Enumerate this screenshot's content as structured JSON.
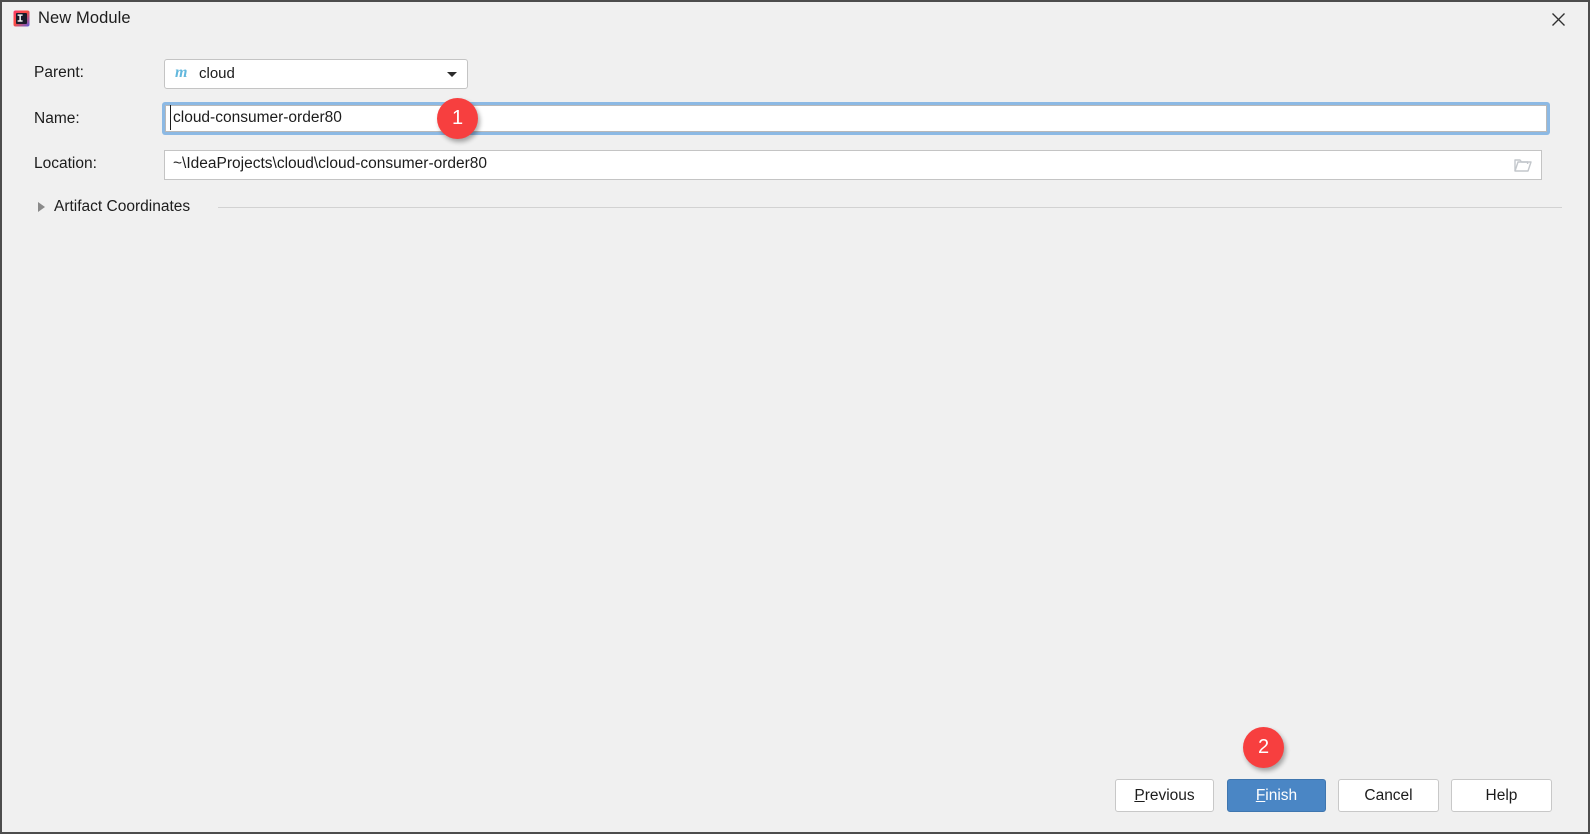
{
  "window": {
    "title": "New Module",
    "app_icon": "intellij-idea-icon",
    "close_icon": "close-icon"
  },
  "form": {
    "parent": {
      "label": "Parent:",
      "value": "cloud",
      "icon": "maven-module-icon",
      "icon_glyph": "m",
      "dropdown_icon": "chevron-down-icon"
    },
    "name": {
      "label": "Name:",
      "value": "cloud-consumer-order80",
      "placeholder": ""
    },
    "location": {
      "label": "Location:",
      "value": "~\\IdeaProjects\\cloud\\cloud-consumer-order80",
      "placeholder": "",
      "browse_icon": "folder-icon"
    }
  },
  "sections": {
    "artifact_coordinates": {
      "title": "Artifact Coordinates",
      "expanded": false,
      "toggle_icon": "triangle-right-icon"
    }
  },
  "buttons": {
    "previous": {
      "prefix": "",
      "mnemonic": "P",
      "suffix": "revious"
    },
    "finish": {
      "prefix": "",
      "mnemonic": "F",
      "suffix": "inish"
    },
    "cancel": {
      "label": "Cancel"
    },
    "help": {
      "label": "Help"
    }
  },
  "annotations": {
    "badge_1": "1",
    "badge_2": "2"
  },
  "colors": {
    "accent": "#4a86c5",
    "badge": "#f73f3f",
    "focus_ring": "#8cb9e4",
    "maven_icon": "#63b8dd",
    "background": "#f0f0f0"
  }
}
